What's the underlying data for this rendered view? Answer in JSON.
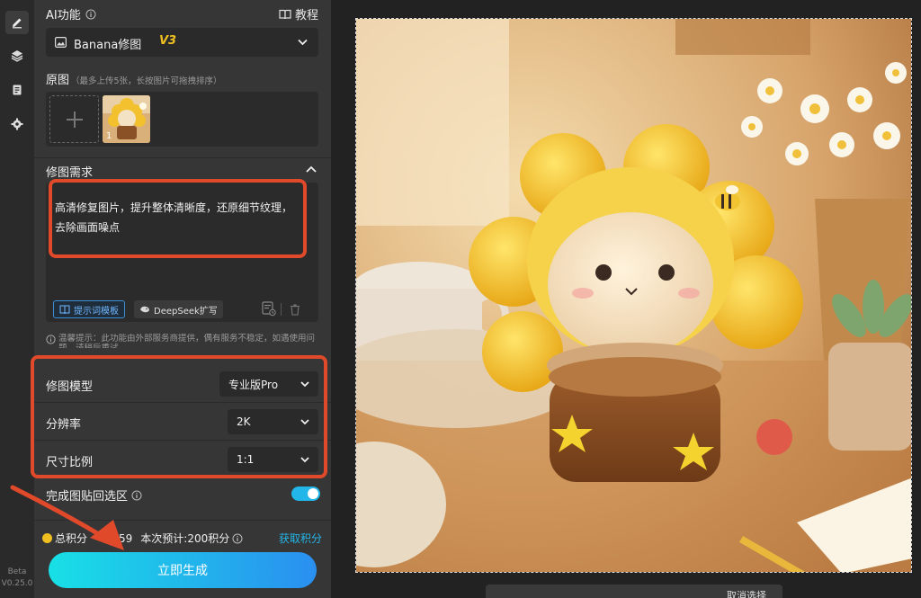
{
  "rail": {
    "beta": "Beta",
    "version": "V0.25.0"
  },
  "ai_section": {
    "title": "AI功能",
    "tutorial": "教程"
  },
  "model_select": {
    "name": "Banana修图",
    "version": "V3"
  },
  "source": {
    "title": "原图",
    "hint": "（最多上传5张，长按图片可拖拽排序）",
    "thumb_index": "1"
  },
  "requirement": {
    "title": "修图需求",
    "text": "高清修复图片，提升整体清晰度，还原细节纹理，去除画面噪点",
    "template_btn": "提示词模板",
    "deepseek_btn": "DeepSeek扩写"
  },
  "tip": "温馨提示：此功能由外部服务商提供，偶有服务不稳定，如遇使用问题，请稍后重试",
  "params": [
    {
      "label": "修图模型",
      "value": "专业版Pro"
    },
    {
      "label": "分辨率",
      "value": "2K"
    },
    {
      "label": "尺寸比例",
      "value": "1:1"
    }
  ],
  "paste_back": {
    "label": "完成图贴回选区",
    "enabled": true
  },
  "points": {
    "total_label": "总积分",
    "total_value": "59",
    "estimate": "本次预计:200积分",
    "get": "获取积分"
  },
  "generate": "立即生成",
  "bottom_toolbar": {
    "cancel": "取消选择"
  },
  "colors": {
    "accent": "#23b6e8",
    "highlight": "#e0492a",
    "gold": "#f0c020"
  }
}
